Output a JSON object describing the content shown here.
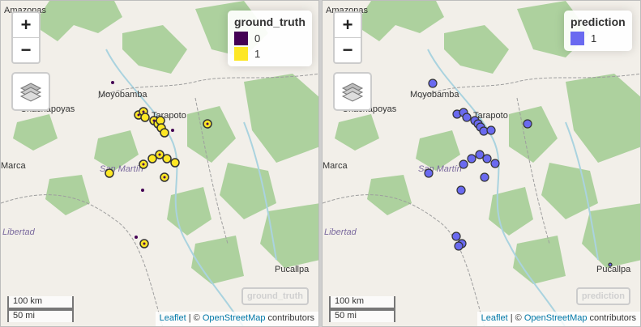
{
  "places": {
    "amazonas": "Amazonas",
    "moyobamba": "Moyobamba",
    "chachapoyas": "Chachapoyas",
    "tarapoto": "Tarapoto",
    "san_martin": "San Martín",
    "marca": "Marca",
    "libertad": "Libertad",
    "pucallpa": "Pucallpa"
  },
  "controls": {
    "zoom_in": "+",
    "zoom_out": "−"
  },
  "scale": {
    "km": "100 km",
    "mi": "50 mi"
  },
  "attribution": {
    "leaflet": "Leaflet",
    "sep": " | © ",
    "osm": "OpenStreetMap",
    "contrib": " contributors"
  },
  "left_map": {
    "legend": {
      "title": "ground_truth",
      "items": [
        {
          "label": "0",
          "color": "#440154"
        },
        {
          "label": "1",
          "color": "#FDE725"
        }
      ]
    },
    "watermark": "ground_truth"
  },
  "right_map": {
    "legend": {
      "title": "prediction",
      "items": [
        {
          "label": "1",
          "color": "#6A6AF0"
        }
      ]
    },
    "watermark": "prediction"
  },
  "colors": {
    "water": "#aad3df",
    "forest": "#add19e",
    "land": "#f2efe9",
    "border": "#9e9e9e"
  }
}
